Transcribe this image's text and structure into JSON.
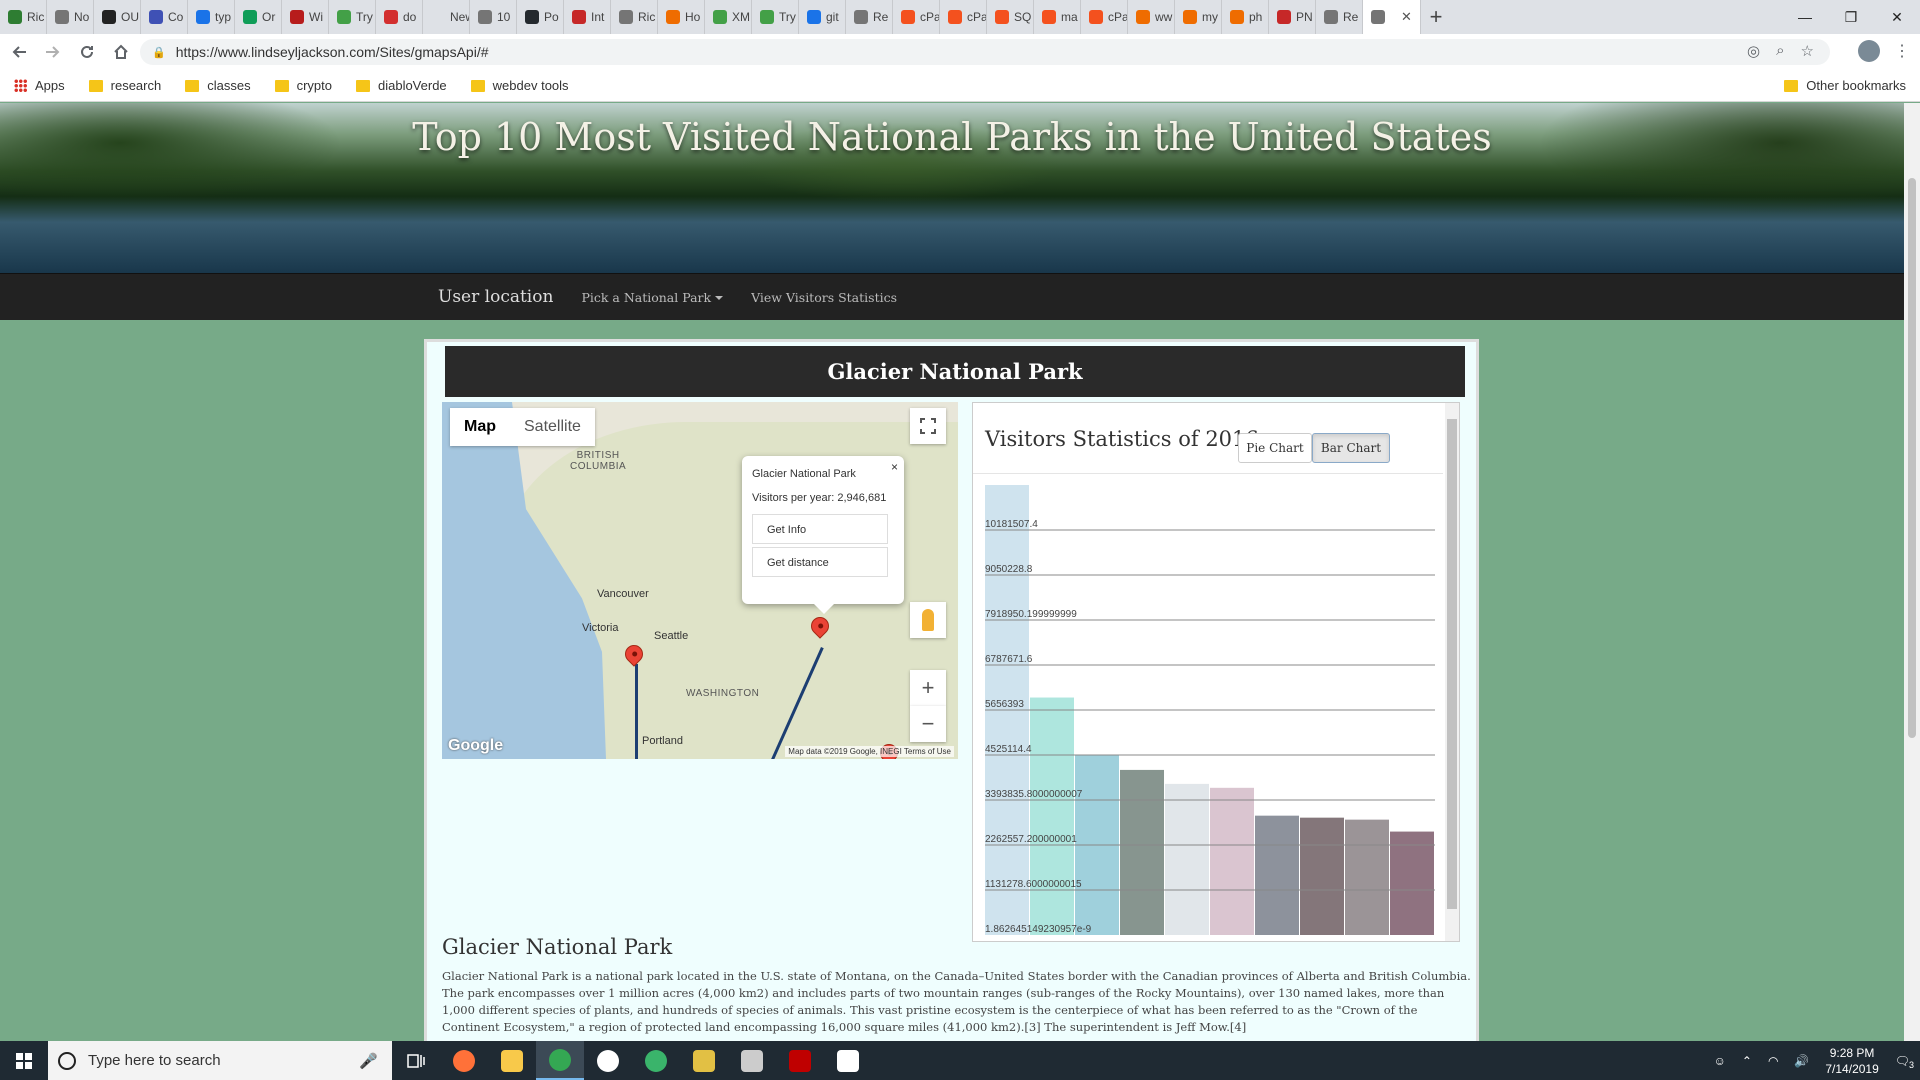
{
  "browser": {
    "tabs": [
      "Ric",
      "No",
      "OU",
      "Co",
      "typ",
      "Or",
      "Wi",
      "Try",
      "do",
      "New Ta",
      "10",
      "Po",
      "Int",
      "Ric",
      "Ho",
      "XM",
      "Try",
      "git",
      "Re",
      "cPa",
      "cPa",
      "SQ",
      "ma",
      "cPa",
      "ww",
      "my",
      "ph",
      "PN",
      "Re",
      ""
    ],
    "tab_colors": [
      "#2e7d32",
      "#757575",
      "#222222",
      "#3f51b5",
      "#1a73e8",
      "#0f9d58",
      "#b71c1c",
      "#43a047",
      "#d32f2f",
      "#dee1e6",
      "#757575",
      "#24292e",
      "#c62828",
      "#757575",
      "#ef6c00",
      "#43a047",
      "#43a047",
      "#1a73e8",
      "#757575",
      "#f4511e",
      "#f4511e",
      "#f4511e",
      "#f4511e",
      "#f4511e",
      "#ef6c00",
      "#ef6c00",
      "#ef6c00",
      "#c62828",
      "#757575",
      "#757575"
    ],
    "new_tab_label": "+",
    "window_buttons": [
      "—",
      "❐",
      "✕"
    ],
    "url": "https://www.lindseyljackson.com/Sites/gmapsApi/#",
    "bookmarks": [
      "research",
      "classes",
      "crypto",
      "diabloVerde",
      "webdev tools"
    ],
    "apps_label": "Apps",
    "other_bookmarks": "Other bookmarks"
  },
  "page": {
    "hero_title": "Top 10 Most Visited National Parks in the United States",
    "nav": {
      "brand": "User location",
      "pick_park": "Pick a National Park",
      "view_stats": "View Visitors Statistics"
    },
    "panel_title": "Glacier National Park",
    "map": {
      "type_map": "Map",
      "type_satellite": "Satellite",
      "labels": {
        "bc": "BRITISH\nCOLUMBIA",
        "vancouver": "Vancouver",
        "victoria": "Victoria",
        "seattle": "Seattle",
        "washington": "WASHINGTON",
        "portland": "Portland"
      },
      "infowindow": {
        "title": "Glacier National Park",
        "visitors": "Visitors per year: 2,946,681",
        "get_info": "Get Info",
        "get_distance": "Get distance"
      },
      "google": "Google",
      "attribution": "Map data ©2019 Google, INEGI   Terms of Use"
    },
    "stats": {
      "title": "Visitors Statistics of 2016",
      "pie_button": "Pie Chart",
      "bar_button": "Bar Chart"
    },
    "park_heading": "Glacier National Park",
    "park_description": "Glacier National Park is a national park located in the U.S. state of Montana, on the Canada–United States border with the Canadian provinces of Alberta and British Columbia. The park encompasses over 1 million acres (4,000 km2) and includes parts of two mountain ranges (sub-ranges of the Rocky Mountains), over 130 named lakes, more than 1,000 different species of plants, and hundreds of species of animals. This vast pristine ecosystem is the centerpiece of what has been referred to as the \"Crown of the Continent Ecosystem,\" a region of protected land encompassing 16,000 square miles (41,000 km2).[3] The superintendent is Jeff Mow.[4]"
  },
  "chart_data": {
    "type": "bar",
    "title": "Visitors Statistics of 2016",
    "ylim": [
      0,
      11312786
    ],
    "yticks": [
      "1.862645149230957e-9",
      "1131278.6000000015",
      "2262557.200000001",
      "3393835.8000000007",
      "4525114.4",
      "5656393",
      "6787671.6",
      "7918950.199999999",
      "9050228.8",
      "10181507.4"
    ],
    "values": [
      11312786,
      5969811,
      4517585,
      4150217,
      3799000,
      3700000,
      3000000,
      2950000,
      2900000,
      2600000
    ],
    "colors": [
      "#cfe3ee",
      "#aee6de",
      "#9fd0dc",
      "#87958f",
      "#e1e6ea",
      "#dac5d0",
      "#8d929c",
      "#84767a",
      "#9b9497",
      "#8f7280"
    ]
  },
  "taskbar": {
    "search_placeholder": "Type here to search",
    "time": "9:28 PM",
    "date": "7/14/2019",
    "notification_count": "3",
    "apps": [
      {
        "name": "firefox",
        "color": "#ff7139"
      },
      {
        "name": "files",
        "color": "#f8c94a"
      },
      {
        "name": "chrome",
        "color": "#34a853"
      },
      {
        "name": "app-circle",
        "color": "#ffffff"
      },
      {
        "name": "app-green",
        "color": "#3ab46b"
      },
      {
        "name": "app-diamond",
        "color": "#e2c044"
      },
      {
        "name": "app-pen",
        "color": "#cccccc"
      },
      {
        "name": "filezilla",
        "color": "#bf0000"
      },
      {
        "name": "photos",
        "color": "#ffffff"
      }
    ]
  }
}
